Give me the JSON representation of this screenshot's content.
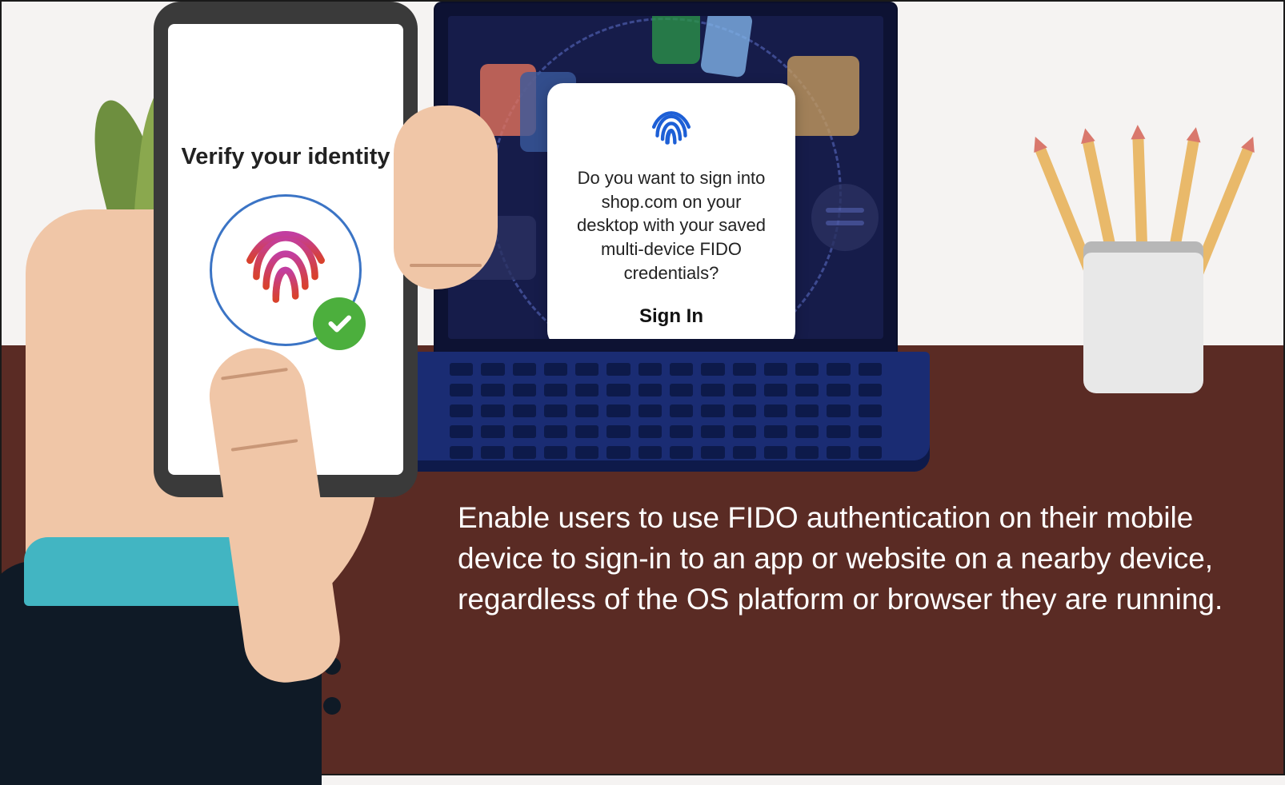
{
  "phone": {
    "title": "Verify your identity"
  },
  "dialog": {
    "message": "Do you want to sign into shop.com on your desktop with your saved multi-device FIDO credentials?",
    "button": "Sign In"
  },
  "caption": "Enable users to use FIDO authentication on their mobile device to sign-in to an app or website on a nearby device, regardless of the OS platform or browser they are running.",
  "icons": {
    "fingerprint_small": "fingerprint-icon",
    "fingerprint_large": "fingerprint-icon",
    "check": "checkmark-icon"
  },
  "colors": {
    "desk": "#5a2b24",
    "wall": "#f5f3f2",
    "laptop_screen": "#161c4a",
    "laptop_base": "#1a2c73",
    "accent_blue": "#1d5fd6",
    "success_green": "#4caf3d",
    "cuff": "#42b5c2"
  }
}
